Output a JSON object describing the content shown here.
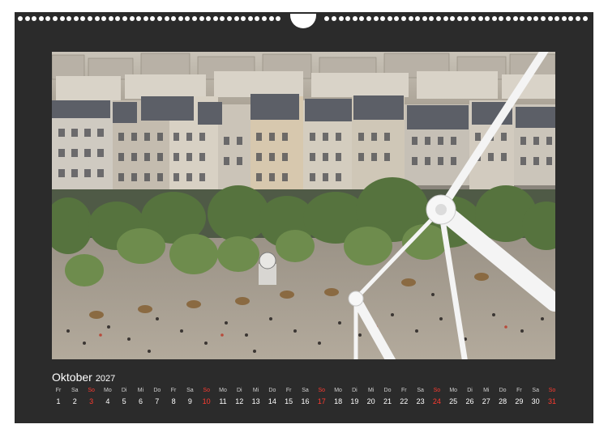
{
  "calendar": {
    "month": "Oktober",
    "year": "2027",
    "weekend_color": "#ff3b30",
    "text_color": "#ffffff",
    "background_color": "#2b2b2b",
    "days": [
      {
        "wd": "Fr",
        "d": "1"
      },
      {
        "wd": "Sa",
        "d": "2"
      },
      {
        "wd": "So",
        "d": "3"
      },
      {
        "wd": "Mo",
        "d": "4"
      },
      {
        "wd": "Di",
        "d": "5"
      },
      {
        "wd": "Mi",
        "d": "6"
      },
      {
        "wd": "Do",
        "d": "7"
      },
      {
        "wd": "Fr",
        "d": "8"
      },
      {
        "wd": "Sa",
        "d": "9"
      },
      {
        "wd": "So",
        "d": "10"
      },
      {
        "wd": "Mo",
        "d": "11"
      },
      {
        "wd": "Di",
        "d": "12"
      },
      {
        "wd": "Mi",
        "d": "13"
      },
      {
        "wd": "Do",
        "d": "14"
      },
      {
        "wd": "Fr",
        "d": "15"
      },
      {
        "wd": "Sa",
        "d": "16"
      },
      {
        "wd": "So",
        "d": "17"
      },
      {
        "wd": "Mo",
        "d": "18"
      },
      {
        "wd": "Di",
        "d": "19"
      },
      {
        "wd": "Mi",
        "d": "20"
      },
      {
        "wd": "Do",
        "d": "21"
      },
      {
        "wd": "Fr",
        "d": "22"
      },
      {
        "wd": "Sa",
        "d": "23"
      },
      {
        "wd": "So",
        "d": "24"
      },
      {
        "wd": "Mo",
        "d": "25"
      },
      {
        "wd": "Di",
        "d": "26"
      },
      {
        "wd": "Mi",
        "d": "27"
      },
      {
        "wd": "Do",
        "d": "28"
      },
      {
        "wd": "Fr",
        "d": "29"
      },
      {
        "wd": "Sa",
        "d": "30"
      },
      {
        "wd": "So",
        "d": "31"
      }
    ]
  }
}
